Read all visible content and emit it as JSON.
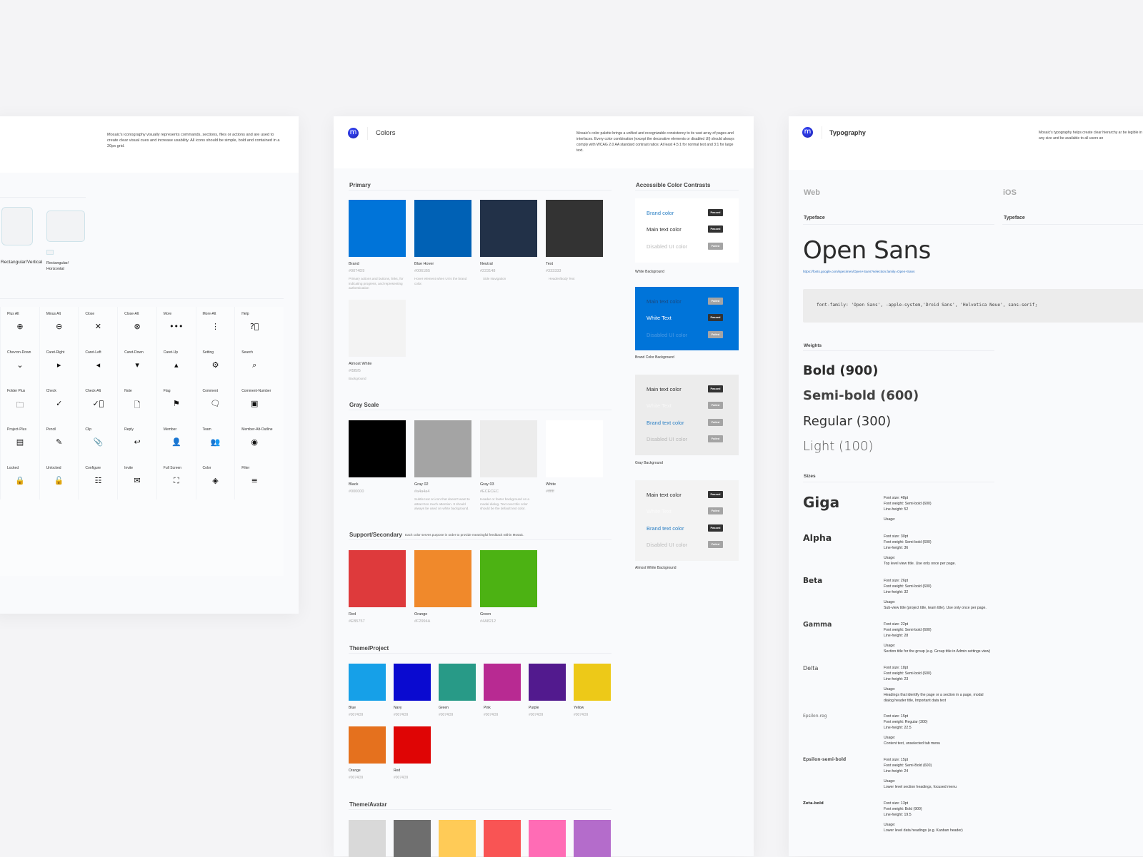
{
  "icons_card": {
    "description": "Mosaic's iconography visually represents commands, sections, files or actions and are used to create clear visual cues and increase usability. All icons should be simple, bold and contained in a 20px grid.",
    "shapes": [
      "Rectangular/Vertical",
      "Rectangular/ Horizontal"
    ],
    "icons": [
      {
        "label": "Plus Alt",
        "icon": "plus-circle",
        "glyph": "⊕"
      },
      {
        "label": "Minus Alt",
        "icon": "minus-circle",
        "glyph": "⊖"
      },
      {
        "label": "Close",
        "icon": "close",
        "glyph": "✕"
      },
      {
        "label": "Close-Alt",
        "icon": "close-circle",
        "glyph": "⊗"
      },
      {
        "label": "More",
        "icon": "more-horizontal",
        "glyph": "•••"
      },
      {
        "label": "More-Alt",
        "icon": "more-vertical",
        "glyph": "⋮"
      },
      {
        "label": "Help",
        "icon": "help",
        "glyph": "?⃝"
      },
      {
        "label": "Chevron-Down",
        "icon": "chevron-down",
        "glyph": "⌄"
      },
      {
        "label": "Caret-Right",
        "icon": "caret-right",
        "glyph": "▸"
      },
      {
        "label": "Caret-Left",
        "icon": "caret-left",
        "glyph": "◂"
      },
      {
        "label": "Caret-Down",
        "icon": "caret-down",
        "glyph": "▾"
      },
      {
        "label": "Caret-Up",
        "icon": "caret-up",
        "glyph": "▴"
      },
      {
        "label": "Setting",
        "icon": "gear",
        "glyph": "⚙"
      },
      {
        "label": "Search",
        "icon": "search",
        "glyph": "⌕"
      },
      {
        "label": "Folder Plus",
        "icon": "folder-plus",
        "glyph": "🗀"
      },
      {
        "label": "Check",
        "icon": "check",
        "glyph": "✓"
      },
      {
        "label": "Check-Alt",
        "icon": "check-circle",
        "glyph": "✓⃝"
      },
      {
        "label": "Note",
        "icon": "note",
        "glyph": "🗋"
      },
      {
        "label": "Flag",
        "icon": "flag",
        "glyph": "⚑"
      },
      {
        "label": "Comment",
        "icon": "comment",
        "glyph": "🗨"
      },
      {
        "label": "Comment-Number",
        "icon": "comment-number",
        "glyph": "▣"
      },
      {
        "label": "Project-Plus",
        "icon": "project-plus",
        "glyph": "▤"
      },
      {
        "label": "Pencil",
        "icon": "pencil",
        "glyph": "✎"
      },
      {
        "label": "Clip",
        "icon": "paperclip",
        "glyph": "📎"
      },
      {
        "label": "Reply",
        "icon": "reply",
        "glyph": "↩"
      },
      {
        "label": "Member",
        "icon": "member",
        "glyph": "👤"
      },
      {
        "label": "Team",
        "icon": "team",
        "glyph": "👥"
      },
      {
        "label": "Member-Alt-Outline",
        "icon": "member-circle",
        "glyph": "◉"
      },
      {
        "label": "Locked",
        "icon": "lock",
        "glyph": "🔒"
      },
      {
        "label": "Unlocked",
        "icon": "unlock",
        "glyph": "🔓"
      },
      {
        "label": "Configure",
        "icon": "sliders",
        "glyph": "☷"
      },
      {
        "label": "Invite",
        "icon": "envelope",
        "glyph": "✉"
      },
      {
        "label": "Full Screen",
        "icon": "fullscreen",
        "glyph": "⛶"
      },
      {
        "label": "Color",
        "icon": "paint-bucket",
        "glyph": "◈"
      },
      {
        "label": "Filter",
        "icon": "filter",
        "glyph": "≡"
      }
    ]
  },
  "colors_card": {
    "title": "Colors",
    "logo": "m",
    "description": "Mosaic's color palette brings a unified and recognizable consistency to its vast array of pages and interfaces. Every color combination (except the decorative elements or disabled UI) should always comply with WCAG 2.0 AA standard contrast ratios: At least 4.5:1 for normal text and 3:1 for large text.",
    "primary": {
      "title": "Primary",
      "swatches": [
        {
          "name": "Brand",
          "hex": "#0074D9",
          "color": "#0074d9",
          "note": "Primary actions and buttons, links, for indicating progress, and representing authentication"
        },
        {
          "name": "Blue Hover",
          "hex": "#0061B5",
          "color": "#0061b5",
          "note": "Hover element when UI is the brand color."
        },
        {
          "name": "Neutral",
          "hex": "#223148",
          "color": "#223148",
          "note": "Side Navigation"
        },
        {
          "name": "Text",
          "hex": "#333333",
          "color": "#333333",
          "note": "Header/Body Text"
        },
        {
          "name": "Almost White",
          "hex": "#f5f5f5",
          "color": "#f3f3f3",
          "note": "Background"
        }
      ]
    },
    "gray": {
      "title": "Gray Scale",
      "swatches": [
        {
          "name": "Black",
          "hex": "#000000",
          "color": "#000000",
          "note": ""
        },
        {
          "name": "Gray 02",
          "hex": "#a4a4a4",
          "color": "#a4a4a4",
          "note": "Subtle text or icon that doesn't want to attract too much attention. It should always be used on white background."
        },
        {
          "name": "Gray 03",
          "hex": "#ECECEC",
          "color": "#ececec",
          "note": "Header or footer background on a modal dialog. Text over this color should be the default text color."
        },
        {
          "name": "White",
          "hex": "#ffffff",
          "color": "#ffffff",
          "note": ""
        }
      ]
    },
    "support": {
      "title": "Support/Secondary",
      "subtitle": "Each color serves purpose in order to provide meaningful feedback within Mosaic.",
      "swatches": [
        {
          "name": "Red",
          "hex": "#EB5757",
          "color": "#de3a3c"
        },
        {
          "name": "Orange",
          "hex": "#F2994A",
          "color": "#f0892b"
        },
        {
          "name": "Green",
          "hex": "#4A8212",
          "color": "#4cb213"
        }
      ]
    },
    "theme_project": {
      "title": "Theme/Project",
      "swatches": [
        {
          "name": "Blue",
          "hex": "#0074D9",
          "color": "#16a0e8"
        },
        {
          "name": "Navy",
          "hex": "#0074D9",
          "color": "#0a0ad0"
        },
        {
          "name": "Green",
          "hex": "#0074D9",
          "color": "#289a87"
        },
        {
          "name": "Pink",
          "hex": "#0074D9",
          "color": "#b82a92"
        },
        {
          "name": "Purple",
          "hex": "#0074D9",
          "color": "#521a8e"
        },
        {
          "name": "Yellow",
          "hex": "#0074D9",
          "color": "#edc918"
        },
        {
          "name": "Orange",
          "hex": "#0074D9",
          "color": "#e5711e"
        },
        {
          "name": "Red",
          "hex": "#0074D9",
          "color": "#df0505"
        }
      ]
    },
    "theme_avatar": {
      "title": "Theme/Avatar",
      "colors": [
        "#d9d9d9",
        "#6e6e6e",
        "#ffcb57",
        "#f95454",
        "#ff6cb5",
        "#b46ccb"
      ]
    },
    "contrasts": {
      "title": "Accessible Color Contrasts",
      "boxes": [
        {
          "label": "White Background",
          "bg": "#ffffff",
          "rows": [
            {
              "text": "Brand color",
              "color": "#2a7fc4",
              "status": "Passed"
            },
            {
              "text": "Main text color",
              "color": "#333333",
              "status": "Passed"
            },
            {
              "text": "Disabled UI color",
              "color": "#bbbbbb",
              "status": "Failed"
            }
          ]
        },
        {
          "label": "Brand Color Background",
          "bg": "#0074d9",
          "rows": [
            {
              "text": "Main text color",
              "color": "#1a4a80",
              "status": "Failed"
            },
            {
              "text": "White Text",
              "color": "#ffffff",
              "status": "Passed"
            },
            {
              "text": "Disabled UI color",
              "color": "#4a9ae3",
              "status": "Failed"
            }
          ]
        },
        {
          "label": "Gray Background",
          "bg": "#ececec",
          "rows": [
            {
              "text": "Main text color",
              "color": "#333333",
              "status": "Passed"
            },
            {
              "text": "White Text",
              "color": "#f7f7f7",
              "status": "Failed"
            },
            {
              "text": "Brand text color",
              "color": "#2a7fc4",
              "status": "Failed"
            },
            {
              "text": "Disabled UI color",
              "color": "#b8b8b8",
              "status": "Failed"
            }
          ]
        },
        {
          "label": "Almost White Background",
          "bg": "#f3f3f3",
          "rows": [
            {
              "text": "Main text color",
              "color": "#333333",
              "status": "Passed"
            },
            {
              "text": "White Text",
              "color": "#fafafa",
              "status": "Failed"
            },
            {
              "text": "Brand text color",
              "color": "#2a7fc4",
              "status": "Passed"
            },
            {
              "text": "Disabled UI color",
              "color": "#bbbbbb",
              "status": "Failed"
            }
          ]
        }
      ]
    }
  },
  "typography_card": {
    "title": "Typography",
    "logo": "m",
    "description": "Mosaic's typography helps create clear hierarchy ar be legible in any size and be available to all users an",
    "web_label": "Web",
    "ios_label": "iOS",
    "typeface_label": "Typeface",
    "ios_typeface_label": "Typeface",
    "typeface_name": "Open Sans",
    "typeface_link": "https://fonts.google.com/specimen/Open+Sans?selection.family=Open+Sans",
    "font_family_code": "font-family: 'Open Sans', -apple-system,'Droid Sans', 'Helvetica Neue', sans-serif;",
    "weights_label": "Weights",
    "weights": [
      "Bold (900)",
      "Semi-bold (600)",
      "Regular (300)",
      "Light (100)"
    ],
    "sizes_label": "Sizes",
    "sizes": [
      {
        "name": "Giga",
        "specs": [
          "Font size: 48pt",
          "Font weight: Semi-bold (600)",
          "Line-height: 52"
        ],
        "usage_label": "Usage:",
        "usage": ""
      },
      {
        "name": "Alpha",
        "specs": [
          "Font size: 30pt",
          "Font weight: Semi-bold (600)",
          "Line-height: 36"
        ],
        "usage_label": "Usage:",
        "usage": "Top level view title. Use only once per page."
      },
      {
        "name": "Beta",
        "specs": [
          "Font size: 26pt",
          "Font weight: Semi-bold (600)",
          "Line-height: 32"
        ],
        "usage_label": "Usage:",
        "usage": "Sub-view title (project title, team title). Use only once per page."
      },
      {
        "name": "Gamma",
        "specs": [
          "Font size: 22pt",
          "Font weight: Semi-bold (600)",
          "Line-height: 28"
        ],
        "usage_label": "Usage:",
        "usage": "Section title for the group (e.g. Group title in Admin settings view)"
      },
      {
        "name": "Delta",
        "specs": [
          "Font size: 18pt",
          "Font weight: Semi-bold (600)",
          "Line-height: 23"
        ],
        "usage_label": "Usage:",
        "usage": "Headings that identify the page or a section in a page, modal dialog header title, Important data text"
      },
      {
        "name": "Epsilon-reg",
        "specs": [
          "Font size: 15pt",
          "Font weight: Regular (300)",
          "Line-height: 22.5"
        ],
        "usage_label": "Usage:",
        "usage": "Content text, unselected tab menu"
      },
      {
        "name": "Epsilon-semi-bold",
        "specs": [
          "Font size: 15pt",
          "Font weight: Semi-Bold (600)",
          "Line-height: 24"
        ],
        "usage_label": "Usage:",
        "usage": "Lower level section headings, focused menu"
      },
      {
        "name": "Zeta-bold",
        "specs": [
          "Font size: 13pt",
          "Font weight: Bold (900)",
          "Line-height: 19.5"
        ],
        "usage_label": "Usage:",
        "usage": "Lower level data headings (e.g. Kanban header)"
      }
    ]
  }
}
